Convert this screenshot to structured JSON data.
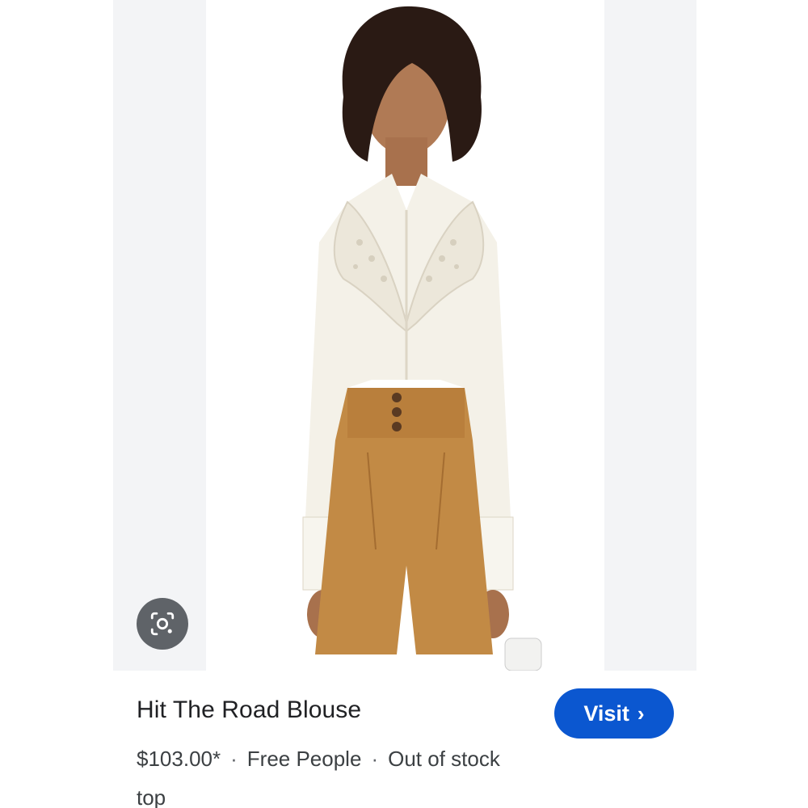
{
  "product": {
    "title": "Hit The Road Blouse",
    "price": "$103.00*",
    "merchant": "Free People",
    "availability": "Out of stock",
    "category": "top",
    "separator": "·"
  },
  "actions": {
    "visit_label": "Visit",
    "visit_chevron": "›",
    "lens_icon": "google-lens-icon"
  },
  "colors": {
    "accent": "#0b57d0",
    "panel_bg": "#f3f4f6",
    "lens_bg": "#5f6368"
  }
}
